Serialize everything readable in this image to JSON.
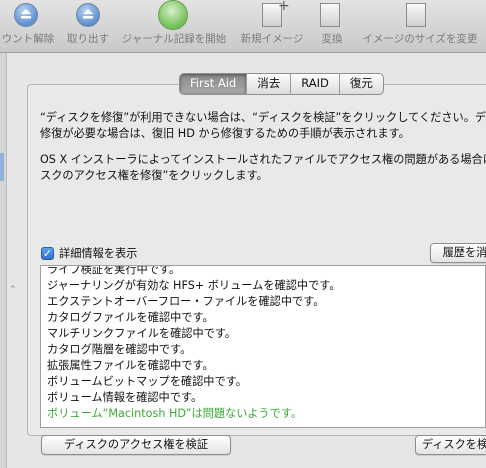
{
  "toolbar": {
    "items": [
      {
        "label": "ウント解除",
        "icon": "unmount-icon"
      },
      {
        "label": "取り出す",
        "icon": "eject-icon"
      },
      {
        "label": "ジャーナル記録を開始",
        "icon": "journaling-icon"
      },
      {
        "label": "新規イメージ",
        "icon": "new-image-icon"
      },
      {
        "label": "変換",
        "icon": "convert-icon"
      },
      {
        "label": "イメージのサイズを変更",
        "icon": "resize-image-icon"
      }
    ]
  },
  "tabs": [
    {
      "label": "First Aid",
      "active": true
    },
    {
      "label": "消去",
      "active": false
    },
    {
      "label": "RAID",
      "active": false
    },
    {
      "label": "復元",
      "active": false
    }
  ],
  "description": {
    "para1_line1": "“ディスクを修復”が利用できない場合は、“ディスクを検証”をクリックしてください。ディ",
    "para1_line2": "修復が必要な場合は、復旧 HD から修復するための手順が表示されます。",
    "para2_line1": "OS X インストーラによってインストールされたファイルでアクセス権の問題がある場合は",
    "para2_line2": "スクのアクセス権を修復”をクリックします。"
  },
  "details": {
    "checkbox_label": "詳細情報を表示",
    "checked": true,
    "clear_history_label": "履歴を消"
  },
  "log": {
    "lines": [
      "ライフ検証を実行中です。",
      "ジャーナリングが有効な HFS+ ボリュームを確認中です。",
      "エクステントオーバーフロー・ファイルを確認中です。",
      "カタログファイルを確認中です。",
      "マルチリンクファイルを確認中です。",
      "カタログ階層を確認中です。",
      "拡張属性ファイルを確認中です。",
      "ボリュームビットマップを確認中です。",
      "ボリューム情報を確認中です。"
    ],
    "result": "ボリューム“Macintosh HD”は問題ないようです。",
    "result_color": "#3aa936"
  },
  "buttons": {
    "verify_permissions": "ディスクのアクセス権を検証",
    "verify_disk": "ディスクを検"
  },
  "colors": {
    "active_tab": "#8a8a8a",
    "checkbox": "#2f6fd1"
  }
}
